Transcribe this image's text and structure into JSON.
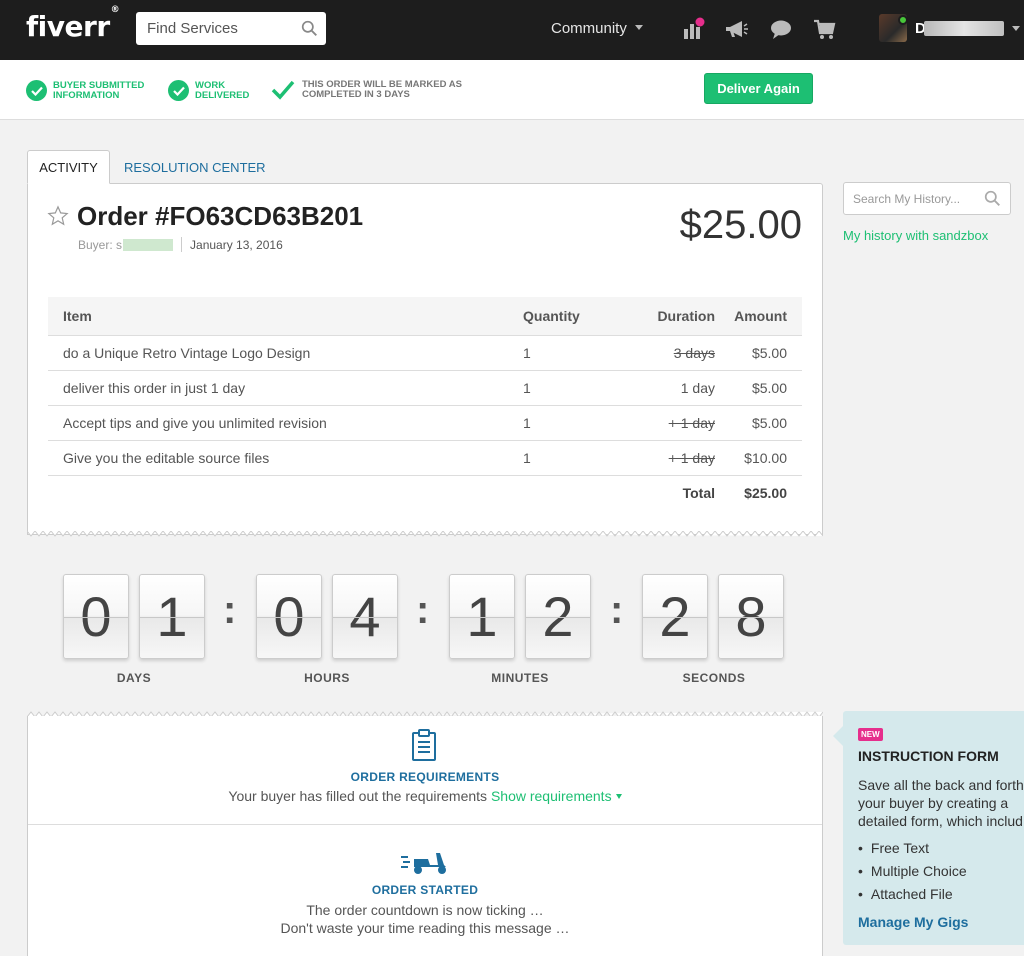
{
  "header": {
    "logo": "fiverr",
    "logo_mark": "®",
    "search_placeholder": "Find Services",
    "community_label": "Community",
    "username": "D",
    "icons": [
      "analytics-icon",
      "megaphone-icon",
      "chat-icon",
      "cart-icon"
    ],
    "colors": {
      "bar": "#1d1d1d",
      "notification_dot": "#e62e8c",
      "online_dot": "#48c73a"
    }
  },
  "status": {
    "steps": [
      {
        "line1": "BUYER SUBMITTED",
        "line2": "INFORMATION"
      },
      {
        "line1": "WORK",
        "line2": "DELIVERED"
      },
      {
        "line1": "THIS ORDER WILL BE MARKED AS",
        "line2": "COMPLETED IN 3 DAYS"
      }
    ],
    "deliver_again": "Deliver Again",
    "accent": "#1dbf73"
  },
  "tabs": [
    "ACTIVITY",
    "RESOLUTION CENTER"
  ],
  "order": {
    "title": "Order #FO63CD63B201",
    "buyer_label": "Buyer: s",
    "date": "January 13, 2016",
    "price": "$25.00",
    "columns": [
      "Item",
      "Quantity",
      "Duration",
      "Amount"
    ],
    "rows": [
      {
        "item": "do a Unique Retro Vintage Logo Design",
        "quantity": "1",
        "duration": "3 days",
        "duration_struck": true,
        "amount": "$5.00"
      },
      {
        "item": "deliver this order in just 1 day",
        "quantity": "1",
        "duration": "1 day",
        "duration_struck": false,
        "amount": "$5.00"
      },
      {
        "item": "Accept tips and give you unlimited revision",
        "quantity": "1",
        "duration": "+ 1 day",
        "duration_struck": true,
        "amount": "$5.00"
      },
      {
        "item": "Give you the editable source files",
        "quantity": "1",
        "duration": "+ 1 day",
        "duration_struck": true,
        "amount": "$10.00"
      }
    ],
    "total_label": "Total",
    "total_value": "$25.00"
  },
  "countdown": {
    "digits": [
      "0",
      "1",
      "0",
      "4",
      "1",
      "2",
      "2",
      "8"
    ],
    "separator": ":",
    "labels": [
      "DAYS",
      "HOURS",
      "MINUTES",
      "SECONDS"
    ]
  },
  "activity": {
    "requirements": {
      "title": "ORDER REQUIREMENTS",
      "text": "Your buyer has filled out the requirements",
      "link": "Show requirements"
    },
    "started": {
      "title": "ORDER STARTED",
      "line1": "The order countdown is now ticking …",
      "line2": "Don't waste your time reading this message …"
    }
  },
  "sidebar": {
    "search_placeholder": "Search My History...",
    "history_link": "My history with sandzbox",
    "promo": {
      "badge": "NEW",
      "title": "INSTRUCTION FORM",
      "line1": "Save all the back and forth",
      "line2": "your buyer by creating a",
      "line3": "detailed form, which includ",
      "list": [
        "Free Text",
        "Multiple Choice",
        "Attached File"
      ],
      "link": "Manage My Gigs"
    }
  }
}
